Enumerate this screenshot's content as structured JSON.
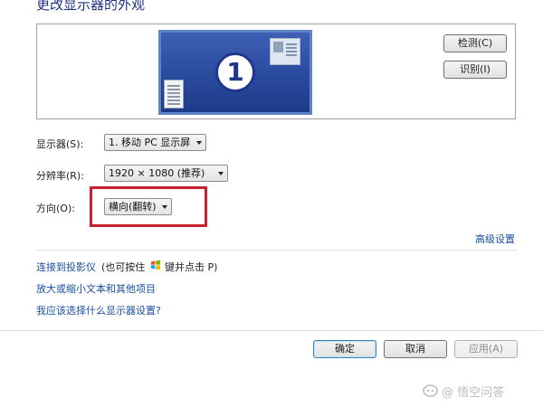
{
  "header": {
    "title": "更改显示器的外观"
  },
  "preview": {
    "monitor_number": "1",
    "detect_label": "检测(C)",
    "identify_label": "识别(I)"
  },
  "settings": {
    "display_label": "显示器(S):",
    "display_value": "1. 移动 PC 显示屏",
    "resolution_label": "分辨率(R):",
    "resolution_value": "1920 × 1080 (推荐)",
    "orientation_label": "方向(O):",
    "orientation_value": "横向(翻转)",
    "advanced_link": "高级设置"
  },
  "links": {
    "projector_link": "连接到投影仪",
    "projector_hint_before": "(也可按住",
    "projector_hint_after": "键并点击 P)",
    "text_size_link": "放大或缩小文本和其他项目",
    "which_settings_link": "我应该选择什么显示器设置?"
  },
  "footer": {
    "ok_label": "确定",
    "cancel_label": "取消",
    "apply_label": "应用(A)"
  },
  "watermark": {
    "text": "@ 悟空问答"
  },
  "colors": {
    "title": "#1e3287",
    "link": "#1a4fa0",
    "highlight": "#c8202d",
    "monitor": "#2a4a9f"
  },
  "icons": {
    "windows_key": "windows-logo-icon",
    "watermark": "wukong-logo-icon"
  }
}
